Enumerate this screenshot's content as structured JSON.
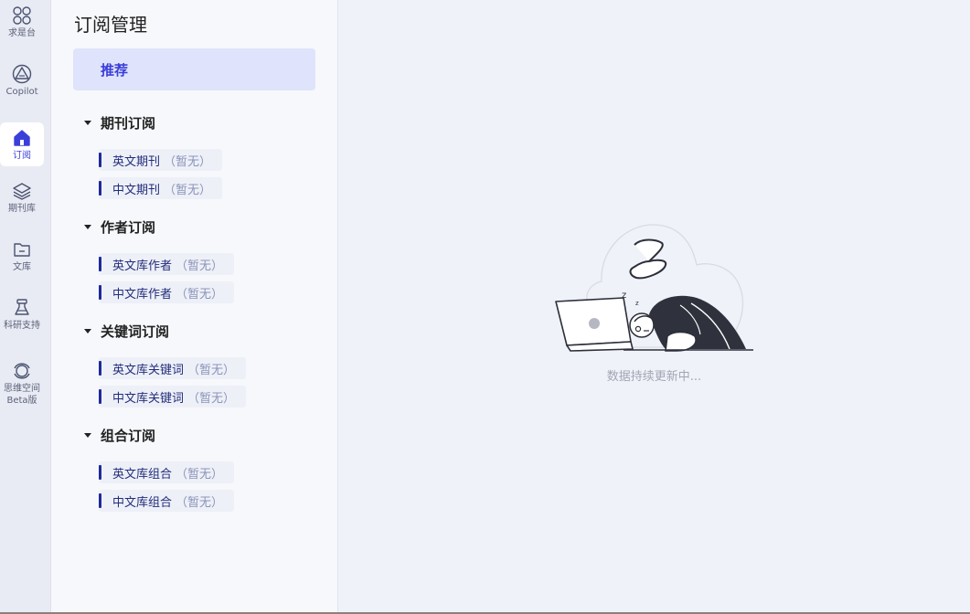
{
  "rail": {
    "items": [
      {
        "label": "求是台",
        "icon": "grid-icon"
      },
      {
        "label": "Copilot",
        "icon": "triangle-copilot-icon"
      },
      {
        "label": "订阅",
        "icon": "home-icon",
        "active": true
      },
      {
        "label": "期刊库",
        "icon": "layers-icon"
      },
      {
        "label": "文库",
        "icon": "folder-icon"
      },
      {
        "label": "科研支持",
        "icon": "flask-icon"
      },
      {
        "label": "思维空间",
        "label2": "Beta版",
        "icon": "orbit-icon"
      }
    ]
  },
  "panel": {
    "title": "订阅管理",
    "recommend_label": "推荐",
    "groups": [
      {
        "title": "期刊订阅",
        "items": [
          {
            "name": "英文期刊",
            "tag": "（暂无）"
          },
          {
            "name": "中文期刊",
            "tag": "（暂无）"
          }
        ]
      },
      {
        "title": "作者订阅",
        "items": [
          {
            "name": "英文库作者",
            "tag": "（暂无）"
          },
          {
            "name": "中文库作者",
            "tag": "（暂无）"
          }
        ]
      },
      {
        "title": "关键词订阅",
        "items": [
          {
            "name": "英文库关键词",
            "tag": "（暂无）"
          },
          {
            "name": "中文库关键词",
            "tag": "（暂无）"
          }
        ]
      },
      {
        "title": "组合订阅",
        "items": [
          {
            "name": "英文库组合",
            "tag": "（暂无）"
          },
          {
            "name": "中文库组合",
            "tag": "（暂无）"
          }
        ]
      }
    ]
  },
  "main": {
    "empty_text": "数据持续更新中..."
  },
  "colors": {
    "accent": "#3b3fd9",
    "sub_bar": "#1f2a9a"
  }
}
